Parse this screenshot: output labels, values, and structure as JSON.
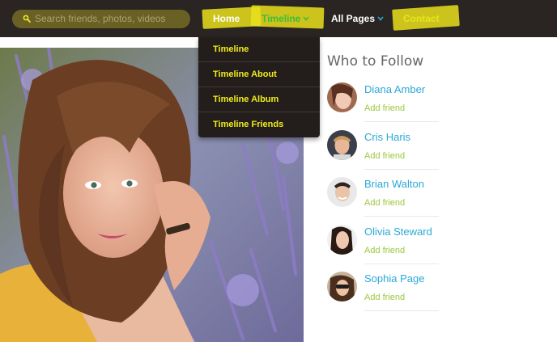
{
  "search": {
    "placeholder": "Search friends, photos, videos"
  },
  "nav": {
    "home": "Home",
    "timeline": "Timeline",
    "all_pages": "All Pages",
    "contact": "Contact"
  },
  "dropdown": {
    "items": [
      "Timeline",
      "Timeline About",
      "Timeline Album",
      "Timeline Friends"
    ]
  },
  "who_to_follow": {
    "title": "Who to Follow",
    "people": [
      {
        "name": "Diana Amber",
        "action": "Add friend"
      },
      {
        "name": "Cris Haris",
        "action": "Add friend"
      },
      {
        "name": "Brian Walton",
        "action": "Add friend"
      },
      {
        "name": "Olivia Steward",
        "action": "Add friend"
      },
      {
        "name": "Sophia Page",
        "action": "Add friend"
      }
    ]
  },
  "colors": {
    "topbar": "#2a2422",
    "highlight": "#e9e11c",
    "timeline_active": "#3dbb3d",
    "dropdown_text": "#f0ec1a",
    "name_link": "#2aa8d8",
    "add_friend": "#9bc83a"
  },
  "icons": {
    "search": "search-icon",
    "chevron": "chevron-down-icon"
  }
}
